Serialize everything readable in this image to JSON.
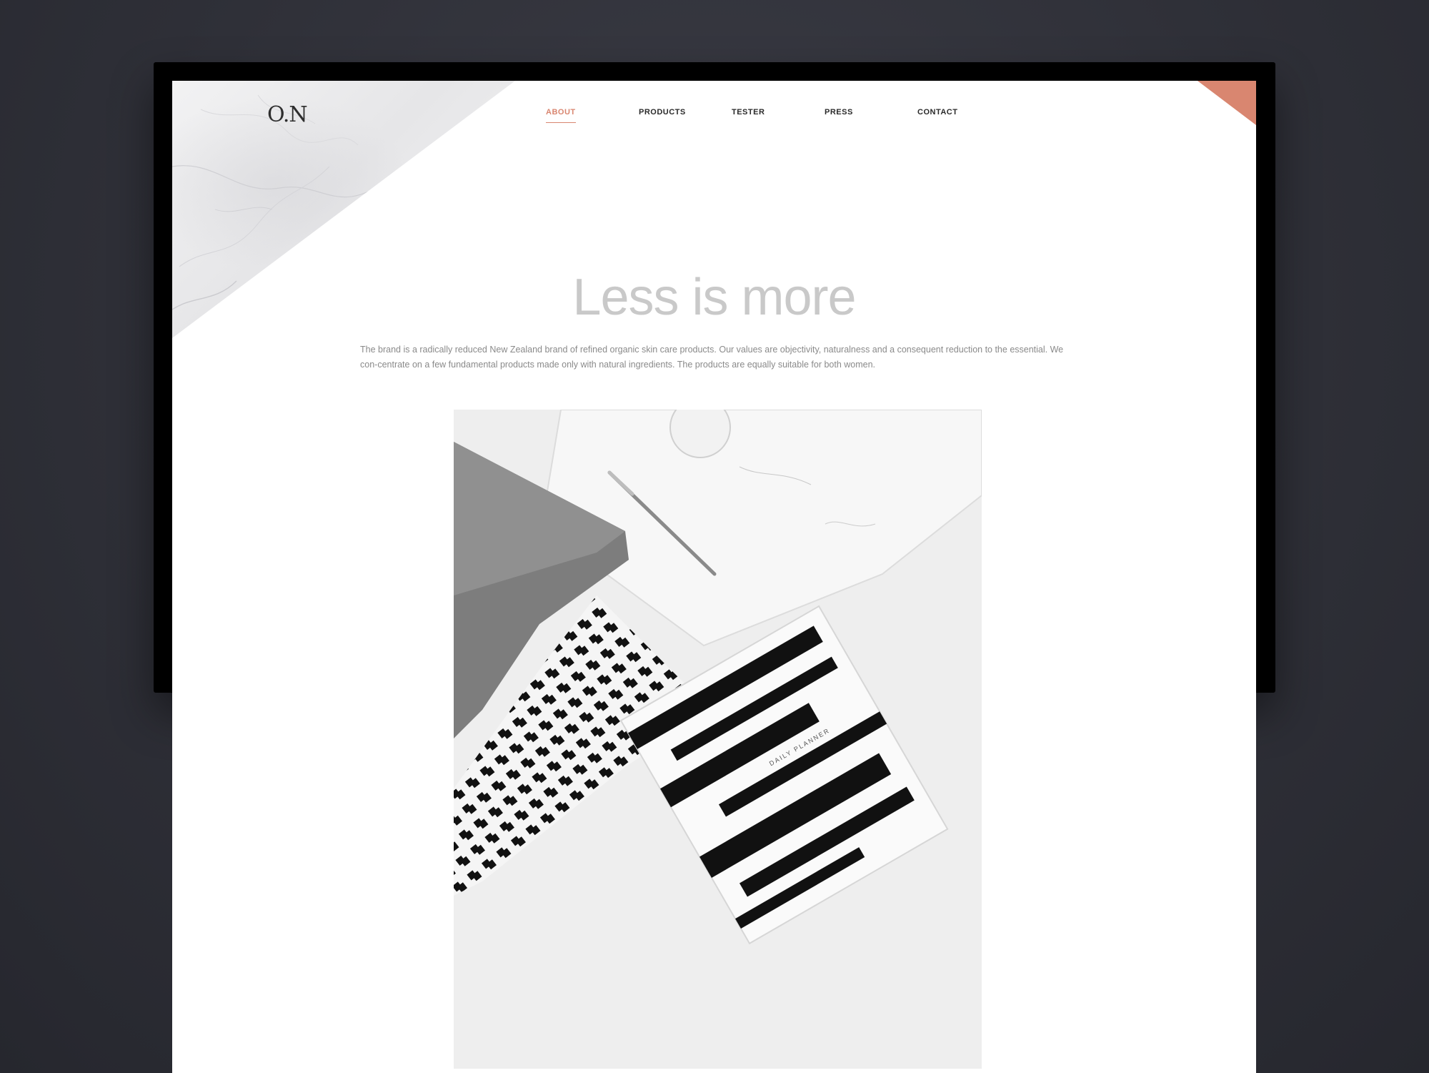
{
  "brand": {
    "logo_text": "O.N"
  },
  "nav": {
    "items": [
      {
        "label": "ABOUT",
        "active": true
      },
      {
        "label": "PRODUCTS",
        "active": false
      },
      {
        "label": "TESTER",
        "active": false
      },
      {
        "label": "PRESS",
        "active": false
      },
      {
        "label": "CONTACT",
        "active": false
      }
    ]
  },
  "hero": {
    "headline": "Less is more",
    "intro": "The brand is a radically reduced New Zealand brand of refined organic skin care products. Our values are objectivity, naturalness and a consequent reduction to the essential. We con-centrate on a few fundamental  products made only with natural ingredients. The products are equally suitable for both women."
  },
  "photo": {
    "planner_label": "DAILY PLANNER"
  },
  "colors": {
    "accent": "#d98670",
    "background": "#2f3038",
    "headline": "#c9c9c9",
    "body_text": "#8a8a8a"
  }
}
